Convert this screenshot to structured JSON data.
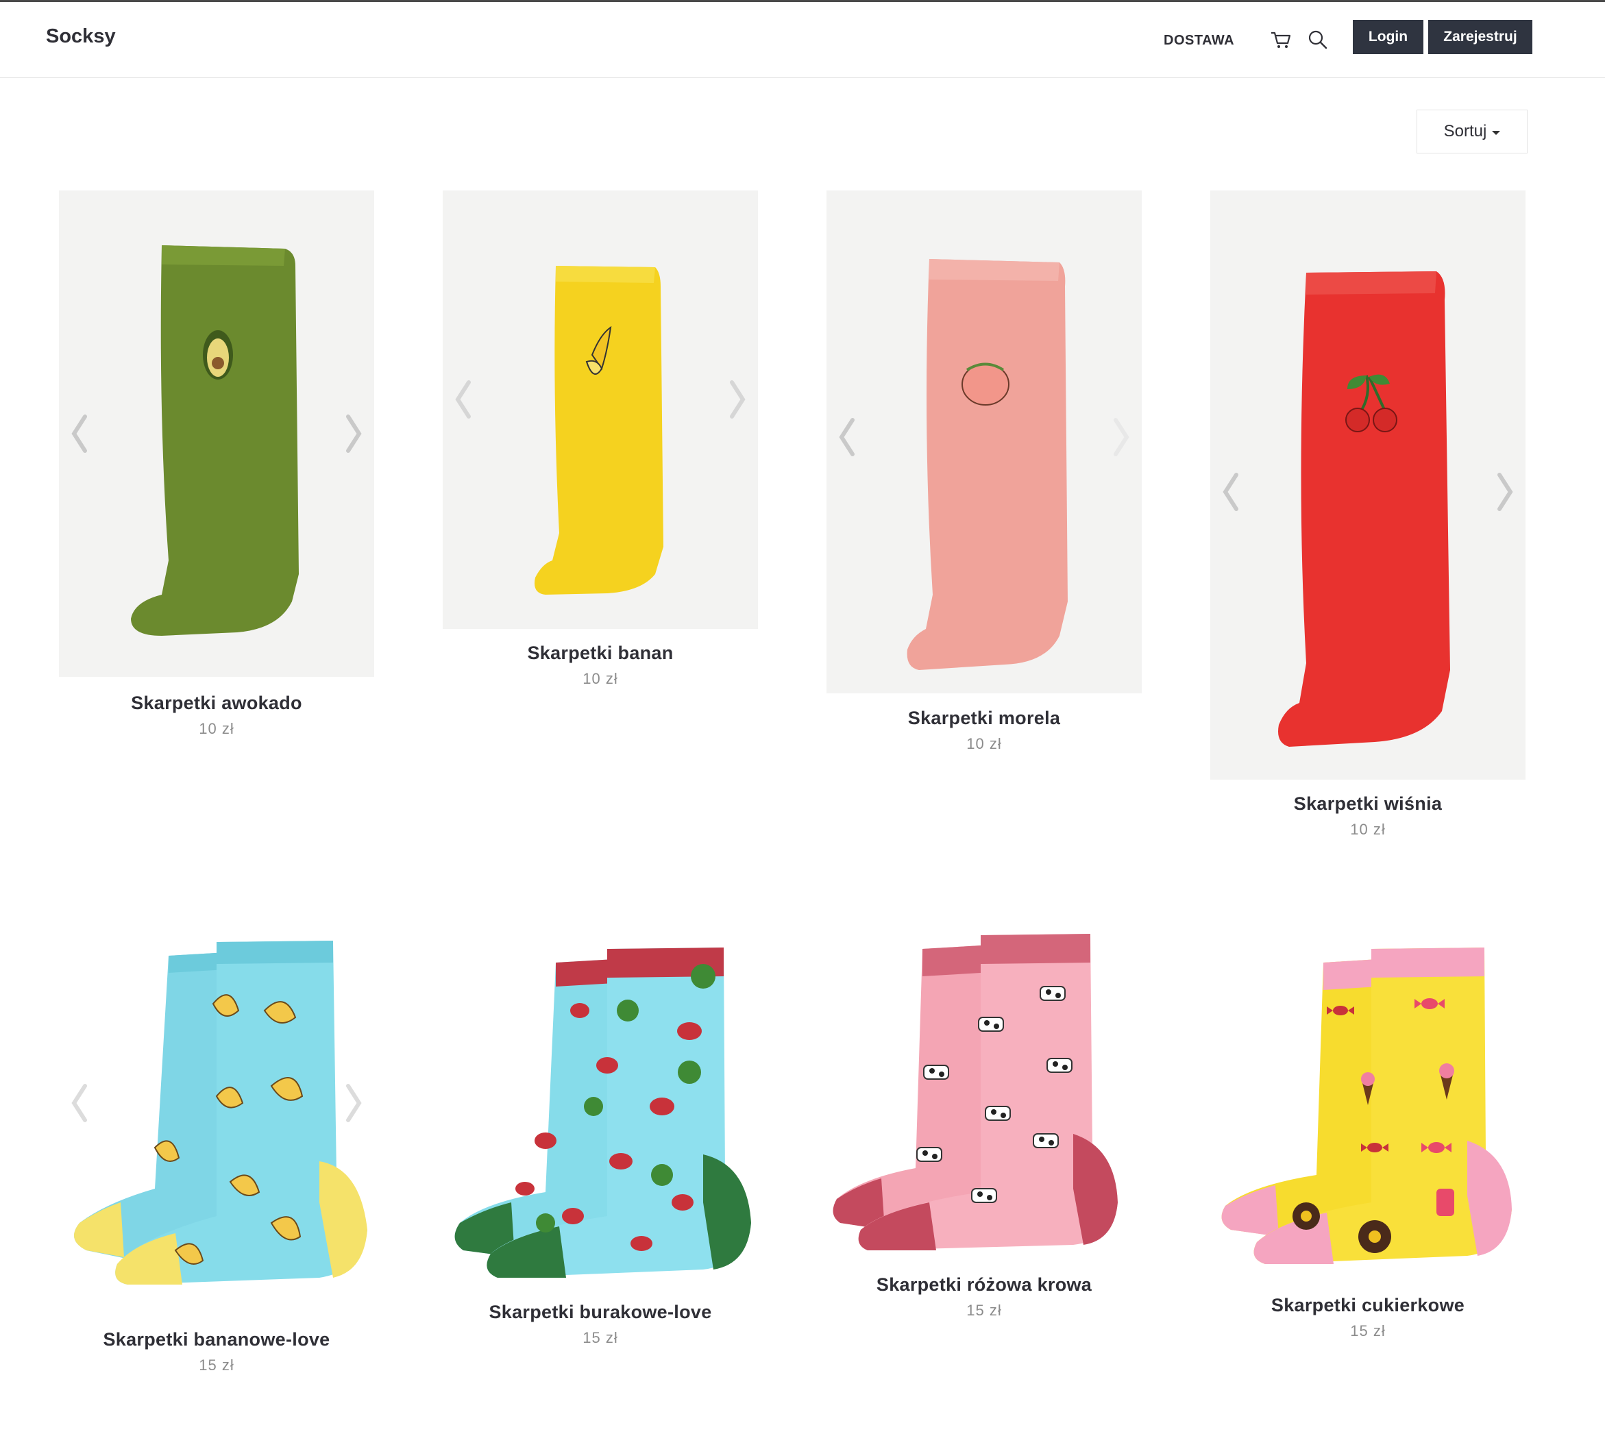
{
  "header": {
    "brand": "Socksy",
    "nav": {
      "delivery": "DOSTAWA"
    },
    "login_label": "Login",
    "register_label": "Zarejestruj"
  },
  "toolbar": {
    "sort_label": "Sortuj"
  },
  "products": [
    {
      "name": "Skarpetki awokado",
      "price": "10 zł"
    },
    {
      "name": "Skarpetki banan",
      "price": "10 zł"
    },
    {
      "name": "Skarpetki morela",
      "price": "10 zł"
    },
    {
      "name": "Skarpetki wiśnia",
      "price": "10 zł"
    },
    {
      "name": "Skarpetki bananowe-love",
      "price": "15 zł"
    },
    {
      "name": "Skarpetki burakowe-love",
      "price": "15 zł"
    },
    {
      "name": "Skarpetki różowa krowa",
      "price": "15 zł"
    },
    {
      "name": "Skarpetki cukierkowe",
      "price": "15 zł"
    }
  ],
  "colors": {
    "accent": "#2f3440",
    "avocado": "#6b8a2e",
    "banana": "#f5d21f",
    "peach": "#f0a39a",
    "cherry": "#e8322f",
    "sky": "#7fd6e6",
    "pink": "#f4a5b4",
    "candy_yellow": "#f7dc2e"
  },
  "icons": {
    "cart": "cart-icon",
    "search": "search-icon",
    "prev": "chevron-left-icon",
    "next": "chevron-right-icon"
  }
}
